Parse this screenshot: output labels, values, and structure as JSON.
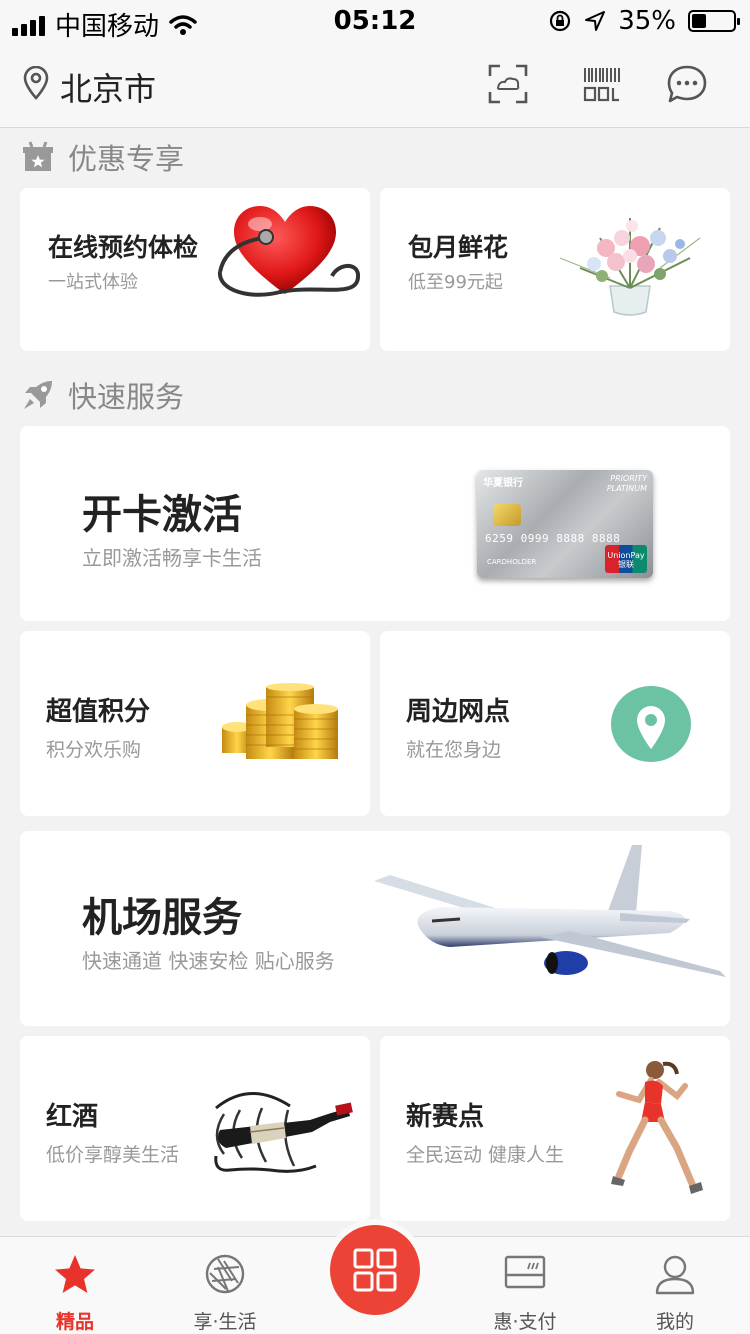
{
  "status_bar": {
    "carrier": "中国移动",
    "time": "05:12",
    "battery": "35%",
    "battery_level": 0.35
  },
  "header": {
    "city": "北京市",
    "icons": [
      "location-icon",
      "scan-icon",
      "barcode-icon",
      "chat-icon"
    ]
  },
  "sections": {
    "exclusive": {
      "title": "优惠专享",
      "icon": "gift-icon"
    },
    "quick": {
      "title": "快速服务",
      "icon": "rocket-icon"
    }
  },
  "cards": {
    "health_check": {
      "title": "在线预约体检",
      "subtitle": "一站式体验"
    },
    "flowers": {
      "title": "包月鲜花",
      "subtitle": "低至99元起"
    },
    "card_activation": {
      "title": "开卡激活",
      "subtitle": "立即激活畅享卡生活",
      "card_brand": "华夏银行",
      "card_tier": "PRIORITY PLATINUM",
      "card_number": "6259 0999 8888 8888",
      "card_holder": "CARDHOLDER",
      "card_logo": "UnionPay 银联"
    },
    "points": {
      "title": "超值积分",
      "subtitle": "积分欢乐购"
    },
    "nearby": {
      "title": "周边网点",
      "subtitle": "就在您身边"
    },
    "airport": {
      "title": "机场服务",
      "subtitle": "快速通道 快速安检 贴心服务"
    },
    "wine": {
      "title": "红酒",
      "subtitle": "低价享醇美生活"
    },
    "running": {
      "title": "新赛点",
      "subtitle": "全民运动 健康人生"
    }
  },
  "tabbar": {
    "tabs": [
      {
        "label": "精品",
        "icon": "star-icon",
        "active": true
      },
      {
        "label": "享·生活",
        "icon": "aperture-icon",
        "active": false
      },
      {
        "label": "",
        "icon": "grid-icon",
        "active": false
      },
      {
        "label": "惠·支付",
        "icon": "card-icon",
        "active": false
      },
      {
        "label": "我的",
        "icon": "user-icon",
        "active": false
      }
    ],
    "accent": "#e8332a"
  },
  "colors": {
    "accent": "#e8332a",
    "center_button": "#ec4336",
    "background": "#f2f2f2",
    "map_pin": "#6bc3a4"
  }
}
